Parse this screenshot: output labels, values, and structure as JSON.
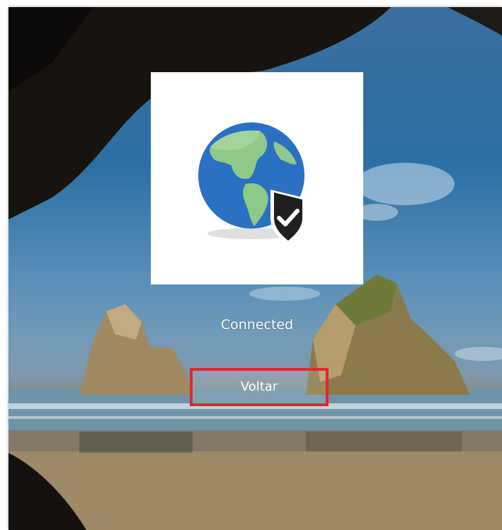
{
  "connection": {
    "status": "Connected",
    "icon": "globe-shield-check-icon"
  },
  "actions": {
    "back_label": "Voltar"
  },
  "colors": {
    "highlight_border": "#e3262e",
    "tile_background": "#ffffff",
    "status_text": "#ffffff"
  }
}
